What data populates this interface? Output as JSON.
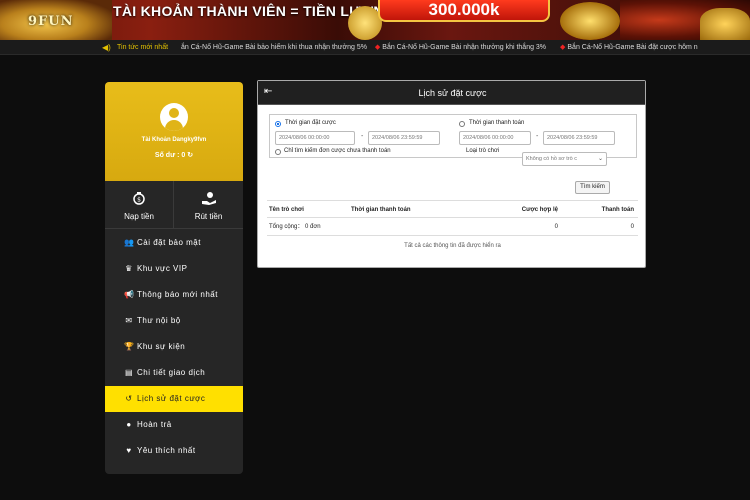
{
  "banner": {
    "logo_text": "9FUN",
    "headline": "TÀI KHOẢN THÀNH VIÊN = TIỀN LƯƠNG",
    "amount": "300.000k"
  },
  "ticker": {
    "label": "Tin tức mới nhất",
    "items": [
      "ắn Cá-Nổ Hũ-Game Bài bảo hiểm khi thua nhận thưởng 5%",
      "Bắn Cá-Nổ Hũ-Game Bài nhận thưởng khi thắng 3%",
      "Bắn Cá-Nổ Hũ-Game Bài đặt cược hôm n"
    ]
  },
  "profile": {
    "account": "Tài Khoản Dangky9fvn",
    "balance": "Số dư : 0"
  },
  "quick_actions": {
    "deposit": "Nạp tiền",
    "withdraw": "Rút tiền"
  },
  "menu": [
    {
      "label": "Cài đặt bảo mật",
      "icon": "users-cog-icon"
    },
    {
      "label": "Khu vực VIP",
      "icon": "crown-icon"
    },
    {
      "label": "Thông báo mới nhất",
      "icon": "megaphone-icon"
    },
    {
      "label": "Thư nội bộ",
      "icon": "envelope-icon"
    },
    {
      "label": "Khu sự kiện",
      "icon": "trophy-icon"
    },
    {
      "label": "Chi tiết giao dịch",
      "icon": "document-icon"
    },
    {
      "label": "Lịch sử đặt cược",
      "icon": "history-icon",
      "active": true
    },
    {
      "label": "Hoàn trả",
      "icon": "refund-icon"
    },
    {
      "label": "Yêu thích nhất",
      "icon": "heart-icon"
    }
  ],
  "main": {
    "title": "Lịch sử đặt cược",
    "bet_time_label": "Thời gian đặt cược",
    "pay_time_label": "Thời gian thanh toán",
    "bet_from": "2024/08/06 00:00:00",
    "bet_to": "2024/08/06 23:59:59",
    "pay_from": "2024/08/06 00:00:00",
    "pay_to": "2024/08/06 23:59:59",
    "unsettled_only": "Chỉ tìm kiếm đơn cược chưa thanh toán",
    "game_type_label": "Loại trò chơi",
    "game_type_value": "Không có hồ sơ trò c",
    "search_button": "Tìm kiếm",
    "columns": [
      "Tên trò chơi",
      "Thời gian thanh toán",
      "Cược hợp lệ",
      "Thanh toán"
    ],
    "total": {
      "label": "Tổng cộng：",
      "count": "0 đơn",
      "valid_bet": "0",
      "payout": "0"
    },
    "note": "Tất cả các thông tin đã được hiển ra"
  },
  "colors": {
    "accent": "#e8bd1a",
    "active_menu": "#ffe000",
    "panel": "#262626"
  }
}
